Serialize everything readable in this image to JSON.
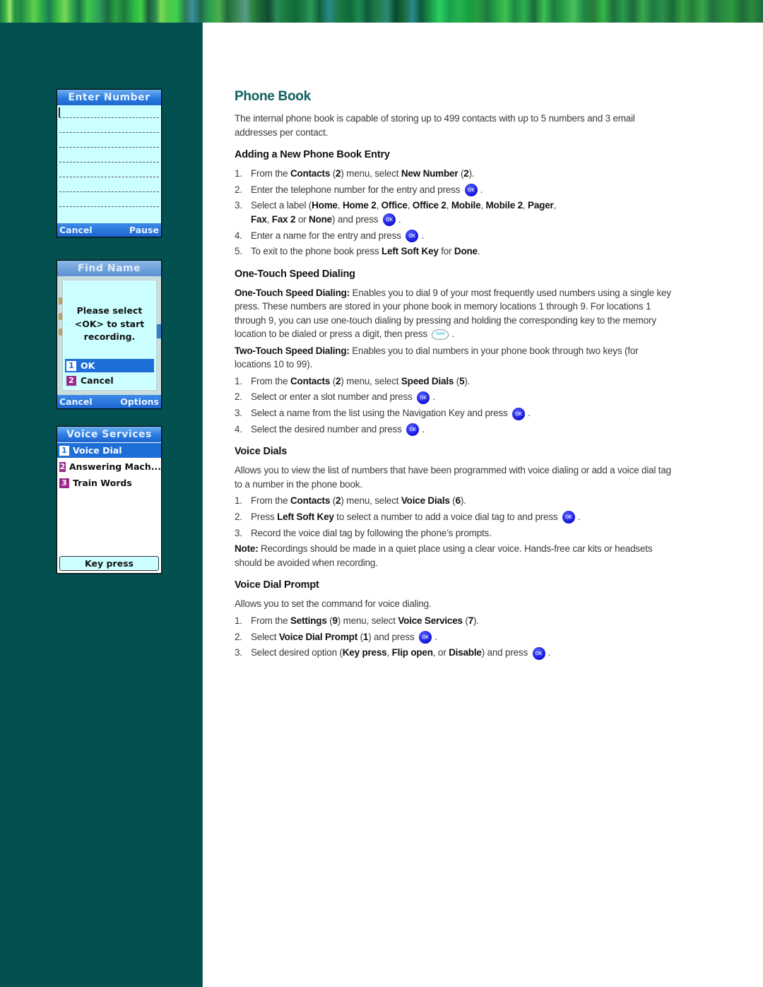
{
  "colors": {
    "sidebar_bg": "#025050",
    "heading_teal": "#0d6060",
    "ok_button_blue": "#1a1ae0",
    "phone_title_blue": "#2a7ae0",
    "phone_screen_cyan": "#ccffff",
    "selection_blue": "#1e6ed8",
    "number_badge_purple": "#9a2a8a"
  },
  "phones": {
    "enter_number": {
      "title": "Enter Number",
      "left_softkey": "Cancel",
      "right_softkey": "Pause"
    },
    "find_name": {
      "title": "Find Name",
      "popup_message": [
        "Please select",
        "<OK> to start",
        "recording."
      ],
      "options": [
        {
          "num": "1",
          "label": "OK"
        },
        {
          "num": "2",
          "label": "Cancel"
        }
      ],
      "left_softkey": "Cancel",
      "right_softkey": "Options"
    },
    "voice_services": {
      "title": "Voice Services",
      "items": [
        {
          "num": "1",
          "label": "Voice Dial"
        },
        {
          "num": "2",
          "label": "Answering Mach..."
        },
        {
          "num": "3",
          "label": "Train Words"
        }
      ],
      "bottom_button": "Key press"
    }
  },
  "icons": {
    "ok": "OK",
    "send": "SEND"
  },
  "content": {
    "title": "Phone Book",
    "intro": "The internal phone book is capable of storing up to 499 contacts with up to 5 numbers and 3 email addresses per contact.",
    "adding": {
      "heading": "Adding a New Phone Book Entry",
      "steps": [
        {
          "n": "1.",
          "parts": [
            {
              "t": "From the "
            },
            {
              "b": "Contacts"
            },
            {
              "t": " ("
            },
            {
              "b": "2"
            },
            {
              "t": ") menu, select "
            },
            {
              "b": "New Number"
            },
            {
              "t": " ("
            },
            {
              "b": "2"
            },
            {
              "t": ")."
            }
          ]
        },
        {
          "n": "2.",
          "parts": [
            {
              "t": "Enter the telephone number for the entry and press "
            },
            {
              "icon": "ok"
            },
            {
              "t": "."
            }
          ]
        },
        {
          "n": "3.",
          "parts": [
            {
              "t": "Select a label ("
            },
            {
              "b": "Home"
            },
            {
              "t": ", "
            },
            {
              "b": "Home 2"
            },
            {
              "t": ", "
            },
            {
              "b": "Office"
            },
            {
              "t": ", "
            },
            {
              "b": "Office 2"
            },
            {
              "t": ", "
            },
            {
              "b": "Mobile"
            },
            {
              "t": ", "
            },
            {
              "b": "Mobile 2"
            },
            {
              "t": ", "
            },
            {
              "b": "Pager"
            },
            {
              "t": ", "
            },
            {
              "br": true
            },
            {
              "b": "Fax"
            },
            {
              "t": ", "
            },
            {
              "b": "Fax 2"
            },
            {
              "t": " or "
            },
            {
              "b": "None"
            },
            {
              "t": ") and press "
            },
            {
              "icon": "ok"
            },
            {
              "t": "."
            }
          ]
        },
        {
          "n": "4.",
          "parts": [
            {
              "t": "Enter a name for the entry and press "
            },
            {
              "icon": "ok"
            },
            {
              "t": "."
            }
          ]
        },
        {
          "n": "5.",
          "parts": [
            {
              "t": "To exit to the phone book press "
            },
            {
              "b": "Left Soft Key"
            },
            {
              "t": " for "
            },
            {
              "b": "Done"
            },
            {
              "t": "."
            }
          ]
        }
      ]
    },
    "speed": {
      "heading": "One-Touch Speed Dialing",
      "one_touch": [
        {
          "b": "One-Touch Speed Dialing:"
        },
        {
          "t": " Enables you to dial 9 of your most frequently used numbers using a single key press. These numbers are stored in your phone book in memory locations 1 through 9. For locations 1 through 9, you can use one-touch dialing by pressing and holding the corresponding key to the memory location to be dialed or press a digit, then press "
        },
        {
          "icon": "send"
        },
        {
          "t": "."
        }
      ],
      "two_touch": [
        {
          "b": "Two-Touch Speed Dialing:"
        },
        {
          "t": " Enables you to dial numbers in your phone book through two keys (for locations 10 to 99)."
        }
      ],
      "steps": [
        {
          "n": "1.",
          "parts": [
            {
              "t": "From the "
            },
            {
              "b": "Contacts"
            },
            {
              "t": " ("
            },
            {
              "b": "2"
            },
            {
              "t": ") menu, select "
            },
            {
              "b": "Speed Dials"
            },
            {
              "t": " ("
            },
            {
              "b": "5"
            },
            {
              "t": ")."
            }
          ]
        },
        {
          "n": "2.",
          "parts": [
            {
              "t": "Select or enter a slot number and press "
            },
            {
              "icon": "ok"
            },
            {
              "t": "."
            }
          ]
        },
        {
          "n": "3.",
          "parts": [
            {
              "t": "Select a name from the list using the Navigation Key and press "
            },
            {
              "icon": "ok"
            },
            {
              "t": "."
            }
          ]
        },
        {
          "n": "4.",
          "parts": [
            {
              "t": "Select the desired number and press "
            },
            {
              "icon": "ok"
            },
            {
              "t": "."
            }
          ]
        }
      ]
    },
    "voice_dials": {
      "heading": "Voice Dials",
      "intro": [
        {
          "t": "Allows you to view the list of numbers that have been programmed with voice dialing or add a voice dial tag to a number in the phone book."
        }
      ],
      "steps": [
        {
          "n": "1.",
          "parts": [
            {
              "t": "From the "
            },
            {
              "b": "Contacts"
            },
            {
              "t": " ("
            },
            {
              "b": "2"
            },
            {
              "t": ") menu, select "
            },
            {
              "b": "Voice Dials"
            },
            {
              "t": " ("
            },
            {
              "b": "6"
            },
            {
              "t": ")."
            }
          ]
        },
        {
          "n": "2.",
          "parts": [
            {
              "t": "Press "
            },
            {
              "b": "Left Soft Key"
            },
            {
              "t": " to select a number to add a voice dial tag to and press "
            },
            {
              "icon": "ok"
            },
            {
              "t": "."
            }
          ]
        },
        {
          "n": "3.",
          "parts": [
            {
              "t": "Record the voice dial tag by following the phone’s prompts."
            }
          ]
        }
      ],
      "note": [
        {
          "b": "Note:"
        },
        {
          "t": " Recordings should be made in a quiet place using a clear voice. Hands-free car kits or headsets should be avoided when recording."
        }
      ]
    },
    "voice_dial_prompt": {
      "heading": "Voice Dial Prompt",
      "intro": [
        {
          "t": "Allows you to set the command for voice dialing."
        }
      ],
      "steps": [
        {
          "n": "1.",
          "parts": [
            {
              "t": "From the "
            },
            {
              "b": "Settings"
            },
            {
              "t": " ("
            },
            {
              "b": "9"
            },
            {
              "t": ") menu, select "
            },
            {
              "b": "Voice Services"
            },
            {
              "t": " ("
            },
            {
              "b": "7"
            },
            {
              "t": ")."
            }
          ]
        },
        {
          "n": "2.",
          "parts": [
            {
              "t": "Select "
            },
            {
              "b": "Voice Dial Prompt"
            },
            {
              "t": " ("
            },
            {
              "b": "1"
            },
            {
              "t": ") and press "
            },
            {
              "icon": "ok"
            },
            {
              "t": "."
            }
          ]
        },
        {
          "n": "3.",
          "parts": [
            {
              "t": "Select desired option ("
            },
            {
              "b": "Key press"
            },
            {
              "t": ", "
            },
            {
              "b": "Flip open"
            },
            {
              "t": ", or "
            },
            {
              "b": "Disable"
            },
            {
              "t": ") and press "
            },
            {
              "icon": "ok"
            },
            {
              "t": "."
            }
          ]
        }
      ]
    }
  }
}
